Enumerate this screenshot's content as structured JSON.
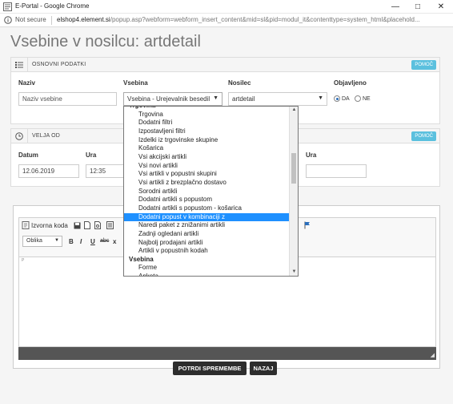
{
  "window": {
    "title": "E-Portal - Google Chrome",
    "not_secure": "Not secure",
    "url_host": "elshop4.element.si",
    "url_path": "/popup.asp?webform=webform_insert_content&mid=sl&pid=modul_it&contenttype=system_html&placehold..."
  },
  "page": {
    "title": "Vsebine v nosilcu: artdetail"
  },
  "panel_basic": {
    "title": "OSNOVNI PODATKI",
    "help": "POMOČ",
    "naziv_label": "Naziv",
    "naziv_placeholder": "Naziv vsebine",
    "vsebina_label": "Vsebina",
    "vsebina_value": "Vsebina - Urejevalnik besedil",
    "nosilec_label": "Nosilec",
    "nosilec_value": "artdetail",
    "objavljeno_label": "Objavljeno",
    "radio_da": "DA",
    "radio_ne": "NE"
  },
  "panel_valid": {
    "title": "VELJA OD",
    "help": "POMOČ",
    "datum_label": "Datum",
    "datum_value": "12.06.2019",
    "ura_label": "Ura",
    "ura_value": "12:35",
    "ura2_label": "Ura",
    "ura2_value": ""
  },
  "editor": {
    "source_label": "Izvorna koda",
    "format_value": "Oblika",
    "bold": "B",
    "italic": "I",
    "underline": "U",
    "strike": "abc",
    "subscript": "x",
    "body_tag": "P"
  },
  "dropdown": {
    "items": [
      {
        "label": "Trgovina",
        "group": true
      },
      {
        "label": "Trgovina",
        "group": false
      },
      {
        "label": "Dodatni filtri",
        "group": false
      },
      {
        "label": "Izpostavljeni filtri",
        "group": false
      },
      {
        "label": "Izdelki iz trgovinske skupine",
        "group": false
      },
      {
        "label": "Košarica",
        "group": false
      },
      {
        "label": "Vsi akcijski artikli",
        "group": false
      },
      {
        "label": "Vsi novi artikli",
        "group": false
      },
      {
        "label": "Vsi artikli v popustni skupini",
        "group": false
      },
      {
        "label": "Vsi artikli z brezplačno dostavo",
        "group": false
      },
      {
        "label": "Sorodni artikli",
        "group": false
      },
      {
        "label": "Dodatni artikli s popustom",
        "group": false
      },
      {
        "label": "Dodatni artikli s popustom - košarica",
        "group": false
      },
      {
        "label": "Dodatni popust v kombinaciji z",
        "group": false,
        "highlight": true
      },
      {
        "label": "Naredi paket z znižanimi artikli",
        "group": false
      },
      {
        "label": "Zadnji ogledani artikli",
        "group": false
      },
      {
        "label": "Najbolj prodajani artikli",
        "group": false
      },
      {
        "label": "Artikli v popustnih kodah",
        "group": false
      },
      {
        "label": "Vsebina",
        "group": true
      },
      {
        "label": "Forme",
        "group": false
      },
      {
        "label": "Anketa",
        "group": false
      }
    ]
  },
  "buttons": {
    "confirm": "POTRDI SPREMEMBE",
    "back": "NAZAJ"
  },
  "colors": {
    "help_button": "#5bc0de",
    "highlight": "#1e90ff",
    "dark_button": "#2d2d2d"
  }
}
